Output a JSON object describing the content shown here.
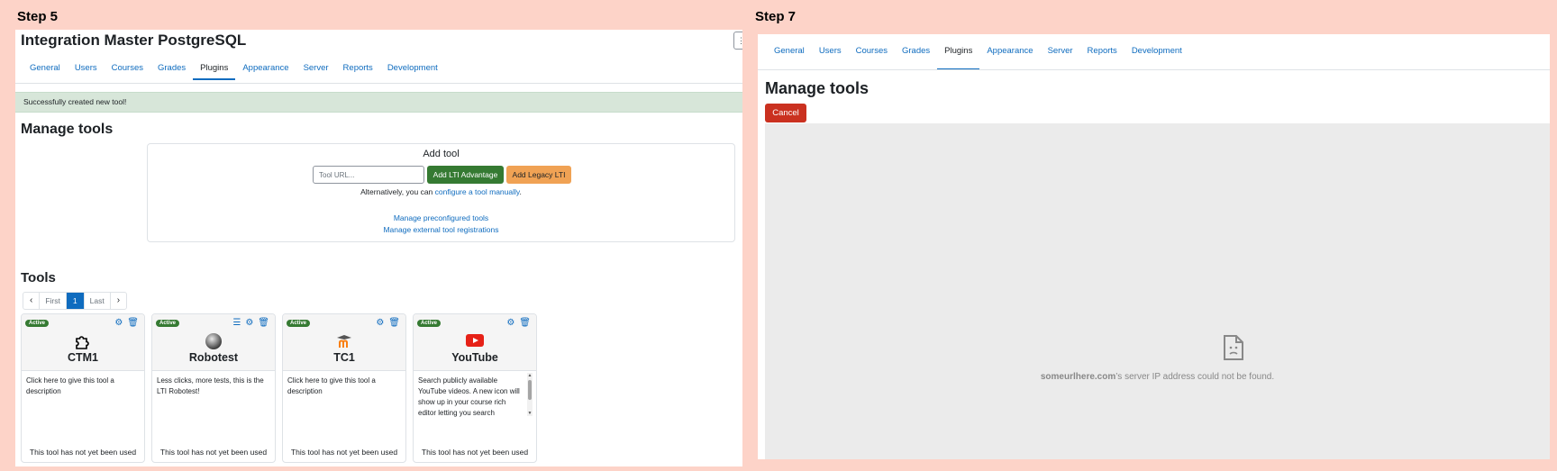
{
  "step_left": "Step 5",
  "step_right": "Step 7",
  "left": {
    "page_title": "Integration Master PostgreSQL",
    "tabs": [
      "General",
      "Users",
      "Courses",
      "Grades",
      "Plugins",
      "Appearance",
      "Server",
      "Reports",
      "Development"
    ],
    "active_tab": "Plugins",
    "alert": "Successfully created new tool!",
    "heading": "Manage tools",
    "add_tool": {
      "title": "Add tool",
      "url_placeholder": "Tool URL...",
      "btn_advantage": "Add LTI Advantage",
      "btn_legacy": "Add Legacy LTI",
      "alt_prefix": "Alternatively, you can ",
      "alt_link": "configure a tool manually",
      "alt_suffix": ".",
      "link_preconfigured": "Manage preconfigured tools",
      "link_external": "Manage external tool registrations"
    },
    "tools_heading": "Tools",
    "pager": {
      "first": "First",
      "current": "1",
      "last": "Last"
    },
    "cards": [
      {
        "badge": "Active",
        "name": "CTM1",
        "icon": "puzzle-piece-icon",
        "description": "Click here to give this tool a description",
        "footer": "This tool has not yet been used"
      },
      {
        "badge": "Active",
        "name": "Robotest",
        "icon": "robot-orb-icon",
        "description": "Less clicks, more tests, this is the LTI Robotest!",
        "footer": "This tool has not yet been used"
      },
      {
        "badge": "Active",
        "name": "TC1",
        "icon": "moodle-logo-icon",
        "description": "Click here to give this tool a description",
        "footer": "This tool has not yet been used"
      },
      {
        "badge": "Active",
        "name": "YouTube",
        "icon": "youtube-logo-icon",
        "description": "Search publicly available YouTube videos. A new icon will show up in your course rich editor letting you search",
        "footer": "This tool has not yet been used"
      }
    ]
  },
  "right": {
    "tabs": [
      "General",
      "Users",
      "Courses",
      "Grades",
      "Plugins",
      "Appearance",
      "Server",
      "Reports",
      "Development"
    ],
    "active_tab": "Plugins",
    "heading": "Manage tools",
    "cancel": "Cancel",
    "error_host": "someurlhere.com",
    "error_suffix": "’s server IP address could not be found."
  },
  "colors": {
    "background": "#fdd3c8",
    "link": "#0f6cbf",
    "success": "#357a32",
    "warning": "#f0a254",
    "danger": "#ca3120",
    "alert_bg": "#d7e6d9"
  }
}
